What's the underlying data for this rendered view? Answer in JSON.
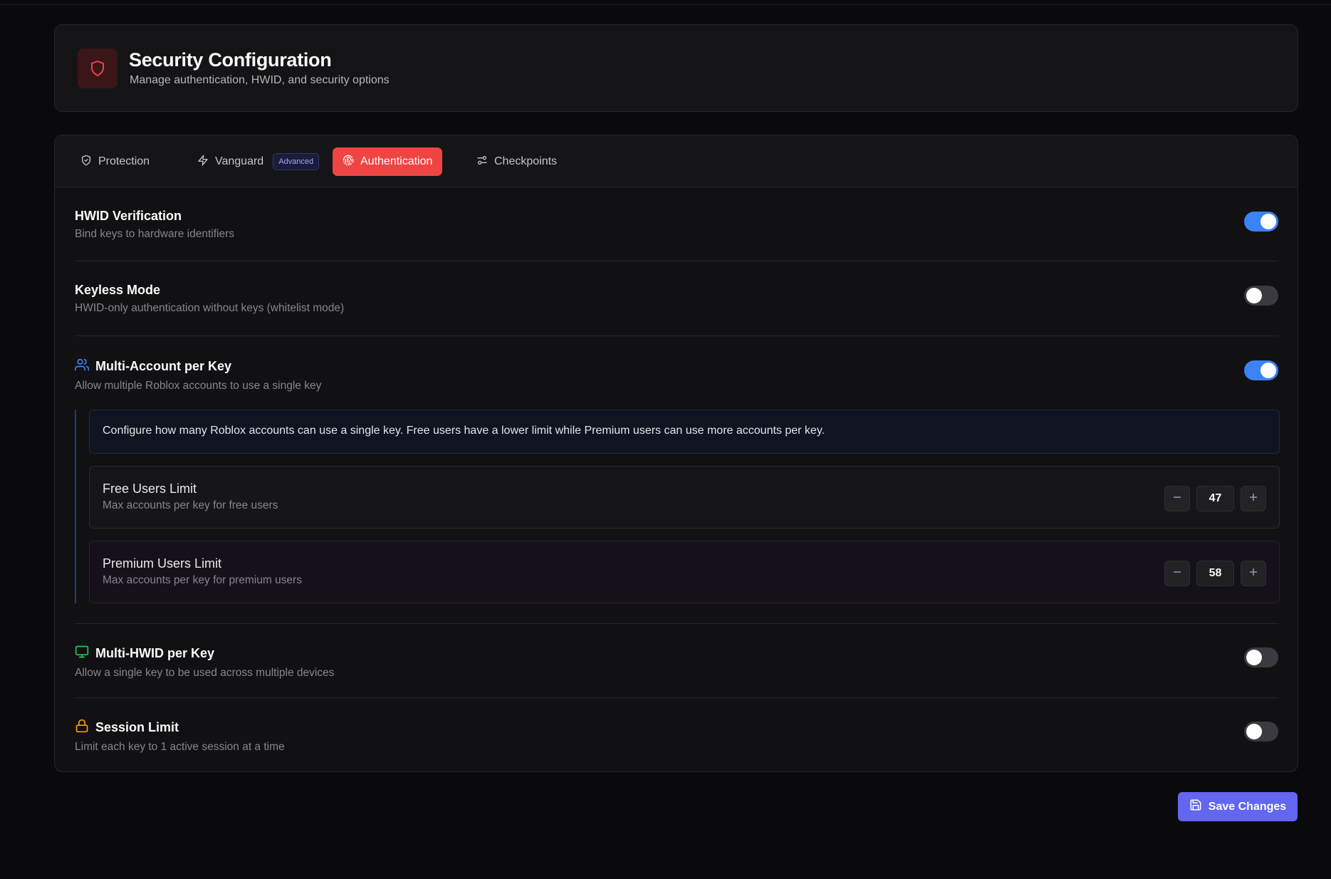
{
  "header": {
    "title": "Security Configuration",
    "subtitle": "Manage authentication, HWID, and security options",
    "icon": "shield-icon",
    "accent": "#ef4444"
  },
  "tabs": [
    {
      "label": "Protection",
      "icon": "shield-check-icon",
      "active": false
    },
    {
      "label": "Vanguard",
      "icon": "lightning-icon",
      "badge": "Advanced",
      "active": false
    },
    {
      "label": "Authentication",
      "icon": "fingerprint-icon",
      "active": true
    },
    {
      "label": "Checkpoints",
      "icon": "sliders-icon",
      "active": false
    }
  ],
  "settings": {
    "hwid": {
      "title": "HWID Verification",
      "desc": "Bind keys to hardware identifiers",
      "enabled": true
    },
    "keyless": {
      "title": "Keyless Mode",
      "desc": "HWID-only authentication without keys (whitelist mode)",
      "enabled": false
    },
    "multi_account": {
      "title": "Multi-Account per Key",
      "desc": "Allow multiple Roblox accounts to use a single key",
      "icon": "users-icon",
      "enabled": true,
      "info": "Configure how many Roblox accounts can use a single key. Free users have a lower limit while Premium users can use more accounts per key.",
      "free": {
        "title": "Free Users Limit",
        "desc": "Max accounts per key for free users",
        "value": "47"
      },
      "premium": {
        "title": "Premium Users Limit",
        "desc": "Max accounts per key for premium users",
        "value": "58"
      }
    },
    "multi_hwid": {
      "title": "Multi-HWID per Key",
      "desc": "Allow a single key to be used across multiple devices",
      "icon": "monitor-icon",
      "enabled": false
    },
    "session": {
      "title": "Session Limit",
      "desc": "Limit each key to 1 active session at a time",
      "icon": "lock-icon",
      "enabled": false
    }
  },
  "footer": {
    "save_label": "Save Changes",
    "icon": "save-icon"
  },
  "colors": {
    "toggle_on": "#3b82f6",
    "toggle_off": "#3a3a40",
    "active_tab": "#ef4444",
    "save_button": "#6366f1"
  }
}
